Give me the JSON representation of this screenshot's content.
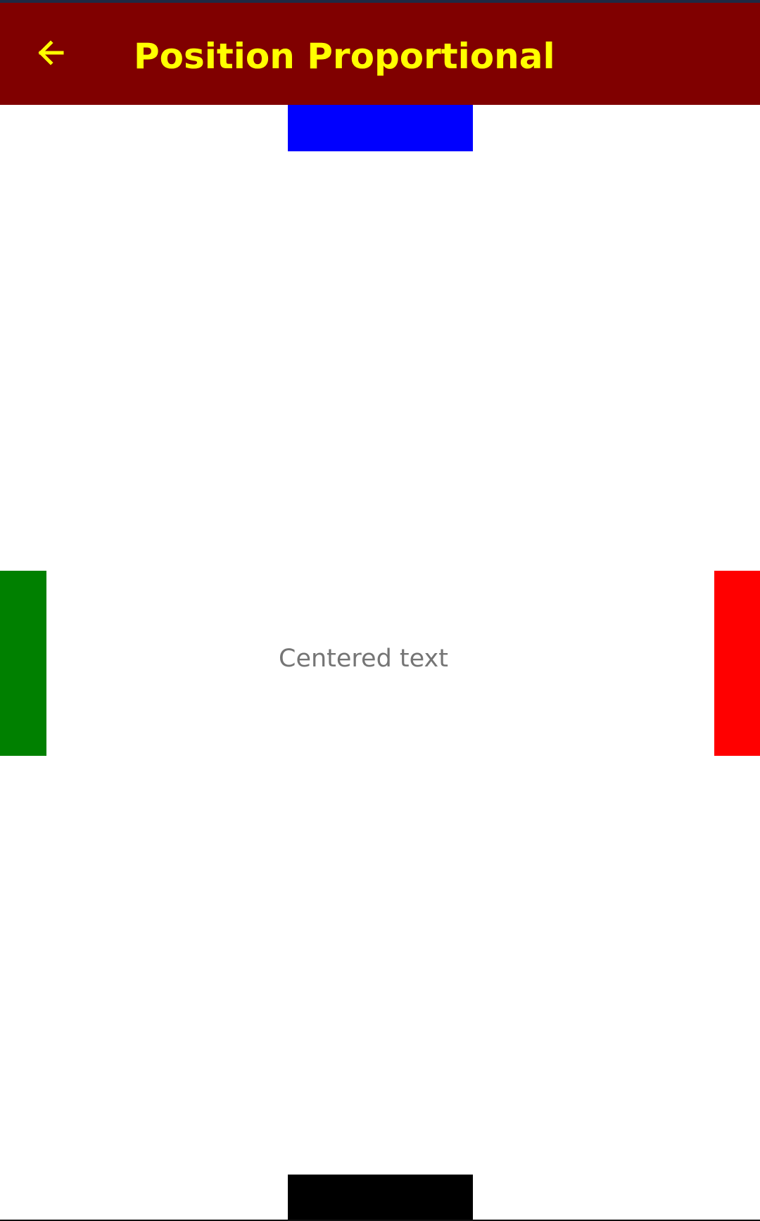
{
  "app_bar": {
    "title": "Position Proportional",
    "background_color": "#800000",
    "foreground_color": "#ffff00",
    "back_icon": "arrow-left-icon"
  },
  "content": {
    "centered_text": "Centered text",
    "text_color": "#757575",
    "boxes": {
      "top_color": "#0000ff",
      "left_color": "#008000",
      "right_color": "#ff0000",
      "bottom_color": "#000000"
    }
  }
}
